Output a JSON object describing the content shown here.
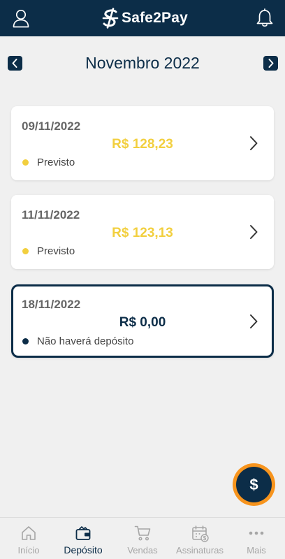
{
  "header": {
    "logo_text": "Safe2Pay",
    "icons": {
      "left": "user-icon",
      "right": "bell-icon"
    }
  },
  "month_bar": {
    "title": "Novembro 2022",
    "prev_icon": "chevron-left-icon",
    "next_icon": "chevron-right-icon"
  },
  "deposits": [
    {
      "date": "09/11/2022",
      "amount": "R$  128,23",
      "status": "Previsto",
      "status_color": "#f2cf3e"
    },
    {
      "date": "11/11/2022",
      "amount": "R$  123,13",
      "status": "Previsto",
      "status_color": "#f2cf3e"
    },
    {
      "date": "18/11/2022",
      "amount": "R$  0,00",
      "status": "Não haverá depósito",
      "status_color": "#0c2d48"
    }
  ],
  "fab": {
    "label": "$",
    "icon": "dollar-icon"
  },
  "tabbar": {
    "active": "Depósito",
    "items": [
      {
        "label": "Início",
        "icon": "home-icon"
      },
      {
        "label": "Depósito",
        "icon": "wallet-icon"
      },
      {
        "label": "Vendas",
        "icon": "cart-icon"
      },
      {
        "label": "Assinaturas",
        "icon": "calendar-dollar-icon"
      },
      {
        "label": "Mais",
        "icon": "more-dots-icon"
      }
    ]
  },
  "colors": {
    "primary": "#0c2d48",
    "accent": "#f7941d",
    "expected": "#f2cf3e",
    "background": "#f0f0f0",
    "inactive": "#a6a6a6"
  }
}
